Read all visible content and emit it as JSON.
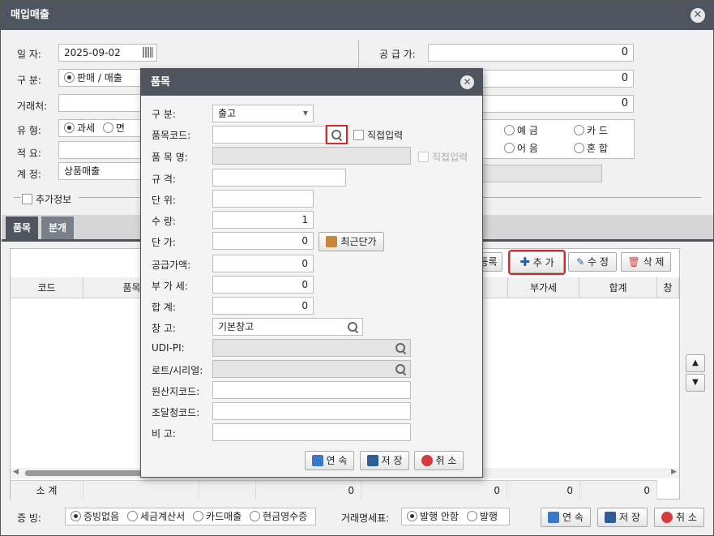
{
  "window": {
    "title": "매입매출",
    "close": "✕"
  },
  "form": {
    "date_label": "일     자:",
    "date_value": "2025-09-02",
    "type_label": "구     분:",
    "type_option": "판매 / 매출",
    "partner_label": "거래처:",
    "category_label": "유     형:",
    "category_opt1": "과세",
    "category_opt2": "면",
    "summary_label": "적     요:",
    "account_label": "계     정:",
    "account_value": "상품매출",
    "extra_label": "추가정보",
    "supply_label": "공 급 가:",
    "supply_value": "0",
    "row2_value": "0",
    "row3_value": "0",
    "pay_opt1": "예 금",
    "pay_opt2": "카 드",
    "pay_opt3": "어 음",
    "pay_opt4": "혼 합"
  },
  "tabs": [
    "품목",
    "분개"
  ],
  "grid": {
    "buttons": {
      "register": "등록",
      "add": "추 가",
      "edit": "수 정",
      "delete": "삭 제"
    },
    "headers": [
      "코드",
      "품목",
      "부가세",
      "합계",
      "창"
    ],
    "footer": {
      "label": "소 계",
      "vals": [
        "0",
        "0",
        "0",
        "0"
      ]
    }
  },
  "bottom": {
    "proof_label": "증 빙:",
    "proof_opts": [
      "증빙없음",
      "세금계산서",
      "카드매출",
      "현금영수증"
    ],
    "statement_label": "거래명세표:",
    "statement_opts": [
      "발행 안함",
      "발행"
    ],
    "btn_continue": "연 속",
    "btn_save": "저 장",
    "btn_cancel": "취 소"
  },
  "modal": {
    "title": "품목",
    "close": "✕",
    "labels": {
      "type": "구     분:",
      "code": "품목코드:",
      "name": "품 목 명:",
      "spec": "규     격:",
      "unit": "단     위:",
      "qty": "수     량:",
      "price": "단     가:",
      "supply": "공급가액:",
      "vat": "부 가 세:",
      "total": "합     계:",
      "warehouse": "창     고:",
      "udi": "UDI-PI:",
      "lot": "로트/시리얼:",
      "origin": "원산지코드:",
      "procure": "조달청코드:",
      "note": "비     고:"
    },
    "values": {
      "type": "출고",
      "qty": "1",
      "price": "0",
      "supply": "0",
      "vat": "0",
      "total": "0",
      "warehouse": "기본창고"
    },
    "direct_input": "직접입력",
    "recent_price": "최근단가",
    "btn_continue": "연 속",
    "btn_save": "저 장",
    "btn_cancel": "취 소"
  }
}
